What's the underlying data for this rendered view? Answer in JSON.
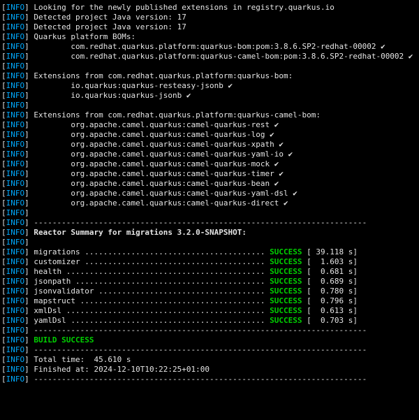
{
  "level_label": "INFO",
  "plain_lines": {
    "l0": "Looking for the newly published extensions in registry.quarkus.io",
    "l1": "Detected project Java version: 17",
    "l2": "Detected project Java version: 17",
    "l3": "Quarkus platform BOMs:"
  },
  "boms": [
    "com.redhat.quarkus.platform:quarkus-bom:pom:3.8.6.SP2-redhat-00002",
    "com.redhat.quarkus.platform:quarkus-camel-bom:pom:3.8.6.SP2-redhat-00002"
  ],
  "ext1_header": "Extensions from com.redhat.quarkus.platform:quarkus-bom:",
  "ext1": [
    "io.quarkus:quarkus-resteasy-jsonb",
    "io.quarkus:quarkus-jsonb"
  ],
  "ext2_header": "Extensions from com.redhat.quarkus.platform:quarkus-camel-bom:",
  "ext2": [
    "org.apache.camel.quarkus:camel-quarkus-rest",
    "org.apache.camel.quarkus:camel-quarkus-log",
    "org.apache.camel.quarkus:camel-quarkus-xpath",
    "org.apache.camel.quarkus:camel-quarkus-yaml-io",
    "org.apache.camel.quarkus:camel-quarkus-mock",
    "org.apache.camel.quarkus:camel-quarkus-timer",
    "org.apache.camel.quarkus:camel-quarkus-bean",
    "org.apache.camel.quarkus:camel-quarkus-yaml-dsl",
    "org.apache.camel.quarkus:camel-quarkus-direct"
  ],
  "sep": "------------------------------------------------------------------------",
  "reactor_header": "Reactor Summary for migrations 3.2.0-SNAPSHOT:",
  "summary": [
    {
      "name": "migrations",
      "status": "SUCCESS",
      "time": "[ 39.118 s]"
    },
    {
      "name": "customizer",
      "status": "SUCCESS",
      "time": "[  1.603 s]"
    },
    {
      "name": "health",
      "status": "SUCCESS",
      "time": "[  0.681 s]"
    },
    {
      "name": "jsonpath",
      "status": "SUCCESS",
      "time": "[  0.689 s]"
    },
    {
      "name": "jsonvalidator",
      "status": "SUCCESS",
      "time": "[  0.780 s]"
    },
    {
      "name": "mapstruct",
      "status": "SUCCESS",
      "time": "[  0.796 s]"
    },
    {
      "name": "xmlDsl",
      "status": "SUCCESS",
      "time": "[  0.613 s]"
    },
    {
      "name": "yamlDsl",
      "status": "SUCCESS",
      "time": "[  0.703 s]"
    }
  ],
  "build_success": "BUILD SUCCESS",
  "total_time": "Total time:  45.610 s",
  "finished_at": "Finished at: 2024-12-10T10:22:25+01:00",
  "check": " ✔",
  "indent_item": "        ",
  "layout": {
    "name_col_width": 50,
    "status_text": "SUCCESS"
  }
}
